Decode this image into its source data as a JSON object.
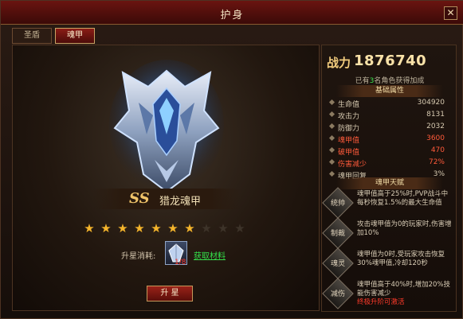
{
  "window": {
    "title": "护身",
    "close_glyph": "✕"
  },
  "tabs": [
    {
      "label": "圣盾",
      "active": false
    },
    {
      "label": "魂甲",
      "active": true
    }
  ],
  "armor": {
    "grade": "SS",
    "name": "猎龙魂甲",
    "stars": {
      "lit": 7,
      "total": 10
    }
  },
  "upgrade": {
    "cost_label": "升星消耗:",
    "item_count": "1/8",
    "acquire_link": "获取材料",
    "button_label": "升 星"
  },
  "combat": {
    "power_label": "战力",
    "power_value": "1876740",
    "bonus_prefix": "已有",
    "bonus_count": "3",
    "bonus_suffix": "名角色获得加成"
  },
  "base_attributes": {
    "header": "基础属性",
    "rows": [
      {
        "label": "生命值",
        "value": "304920",
        "highlight": false
      },
      {
        "label": "攻击力",
        "value": "8131",
        "highlight": false
      },
      {
        "label": "防御力",
        "value": "2032",
        "highlight": false
      },
      {
        "label": "魂甲值",
        "value": "3600",
        "highlight": true
      },
      {
        "label": "破甲值",
        "value": "470",
        "highlight": true
      },
      {
        "label": "伤害减少",
        "value": "72%",
        "highlight": true
      },
      {
        "label": "魂甲回复",
        "value": "3%",
        "highlight": false
      }
    ]
  },
  "talents": {
    "header": "魂甲天赋",
    "items": [
      {
        "icon": "统帅",
        "desc": "魂甲值高于25%时,PVP战斗中每秒恢复1.5%的最大生命值",
        "note": ""
      },
      {
        "icon": "制裁",
        "desc": "攻击魂甲值为0的玩家时,伤害增加10%",
        "note": ""
      },
      {
        "icon": "魂灵",
        "desc": "魂甲值为0时,受玩家攻击恢复30%魂甲值,冷却120秒",
        "note": ""
      },
      {
        "icon": "减伤",
        "desc": "魂甲值高于40%时,增加20%技能伤害减少",
        "note": "终极升阶可激活"
      }
    ]
  },
  "colors": {
    "highlight_value": "#ff5a3a",
    "normal_value": "#d6c9b0",
    "star_on": "#f5b52c",
    "star_off": "#3d3329",
    "link_green": "#34e04a"
  }
}
